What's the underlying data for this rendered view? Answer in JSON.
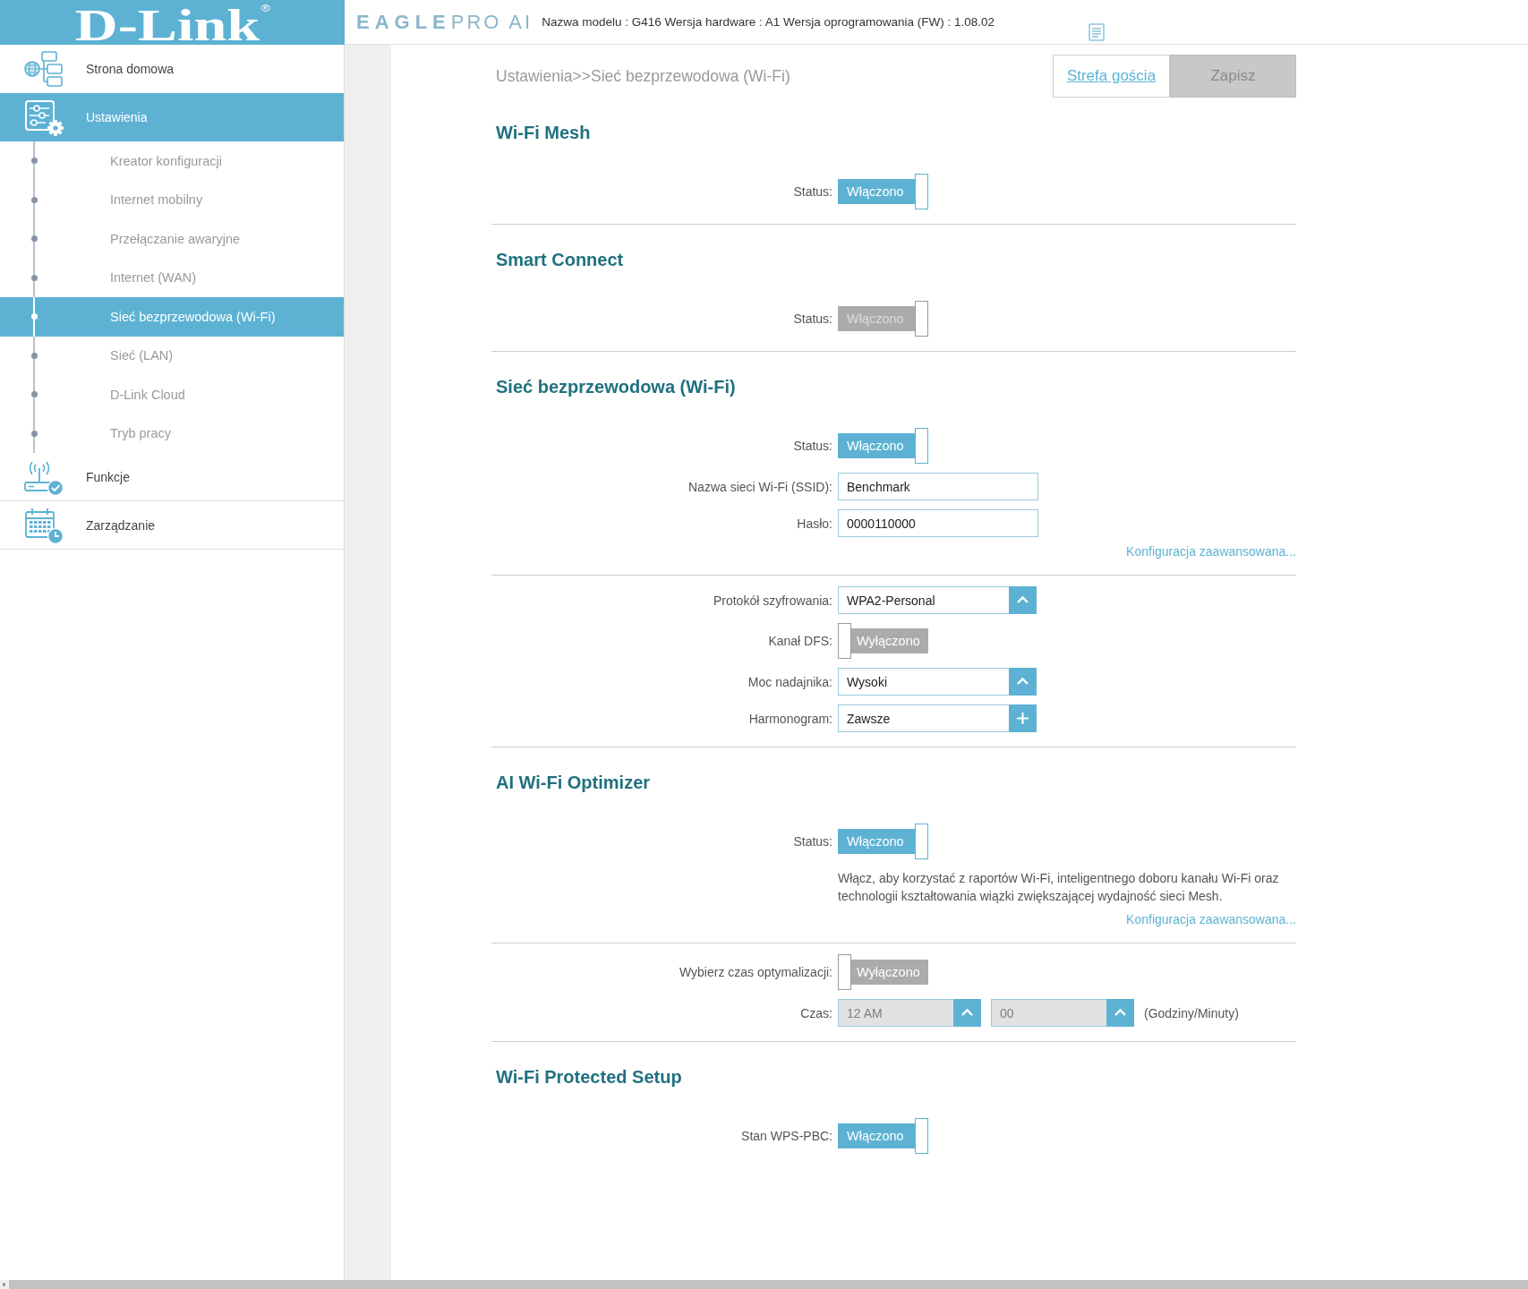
{
  "header": {
    "logo": "D-Link",
    "logo_mark": "®",
    "product": "EAGLE",
    "product_suffix": "PRO AI",
    "model_info": "Nazwa modelu : G416 Wersja hardware : A1 Wersja oprogramowania (FW) : 1.08.02"
  },
  "sidebar": {
    "items": [
      {
        "label": "Strona domowa",
        "selected": false
      },
      {
        "label": "Ustawienia",
        "selected": true,
        "children": [
          {
            "label": "Kreator konfiguracji",
            "selected": false
          },
          {
            "label": "Internet mobilny",
            "selected": false
          },
          {
            "label": "Przełączanie awaryjne",
            "selected": false
          },
          {
            "label": "Internet (WAN)",
            "selected": false
          },
          {
            "label": "Sieć bezprzewodowa (Wi-Fi)",
            "selected": true
          },
          {
            "label": "Sieć (LAN)",
            "selected": false
          },
          {
            "label": "D-Link Cloud",
            "selected": false
          },
          {
            "label": "Tryb pracy",
            "selected": false
          }
        ]
      },
      {
        "label": "Funkcje",
        "selected": false
      },
      {
        "label": "Zarządzanie",
        "selected": false
      }
    ]
  },
  "breadcrumb": "Ustawienia>>Sieć bezprzewodowa (Wi-Fi)",
  "actions": [
    {
      "kind": "link",
      "label": "Strefa gościa"
    },
    {
      "kind": "button",
      "label": "Zapisz",
      "disabled": true
    }
  ],
  "blocks": [
    {
      "title": "Wi-Fi Mesh",
      "rows": [
        {
          "kind": "toggle",
          "label": "Status:",
          "text": "Włączono",
          "on": true,
          "disabled": false
        }
      ]
    },
    {
      "title": "Smart Connect",
      "rows": [
        {
          "kind": "toggle",
          "label": "Status:",
          "text": "Włączono",
          "on": true,
          "disabled": true
        }
      ]
    },
    {
      "title": "Sieć bezprzewodowa (Wi-Fi)",
      "rows": [
        {
          "kind": "toggle",
          "label": "Status:",
          "text": "Włączono",
          "on": true,
          "disabled": false
        },
        {
          "kind": "text",
          "label": "Nazwa sieci Wi-Fi (SSID):",
          "value": "Benchmark"
        },
        {
          "kind": "text",
          "label": "Hasło:",
          "value": "0000110000"
        },
        {
          "kind": "link",
          "text": "Konfiguracja zaawansowana..."
        }
      ]
    },
    {
      "rows": [
        {
          "kind": "select",
          "label": "Protokół szyfrowania:",
          "value": "WPA2-Personal"
        },
        {
          "kind": "toggle",
          "label": "Kanał DFS:",
          "text": "Wyłączono",
          "on": false,
          "disabled": false
        },
        {
          "kind": "select",
          "label": "Moc nadajnika:",
          "value": "Wysoki"
        },
        {
          "kind": "add-select",
          "label": "Harmonogram:",
          "value": "Zawsze"
        }
      ]
    },
    {
      "title": "AI Wi-Fi Optimizer",
      "rows": [
        {
          "kind": "toggle",
          "label": "Status:",
          "text": "Włączono",
          "on": true,
          "disabled": false
        },
        {
          "kind": "note",
          "text": "Włącz, aby korzystać z raportów Wi-Fi, inteligentnego doboru kanału Wi-Fi oraz technologii kształtowania wiązki zwiększającej wydajność sieci Mesh."
        },
        {
          "kind": "link",
          "text": "Konfiguracja zaawansowana..."
        }
      ]
    },
    {
      "rows": [
        {
          "kind": "toggle",
          "label": "Wybierz czas optymalizacji:",
          "text": "Wyłączono",
          "on": false,
          "disabled": false
        },
        {
          "kind": "time",
          "label": "Czas:",
          "fields": [
            {
              "value": "12 AM"
            },
            {
              "value": "00"
            }
          ],
          "unit": "(Godziny/Minuty)",
          "disabled": true
        }
      ]
    },
    {
      "title": "Wi-Fi Protected Setup",
      "rows": [
        {
          "kind": "toggle",
          "label": "Stan WPS-PBC:",
          "text": "Włączono",
          "on": true,
          "disabled": false
        }
      ]
    }
  ]
}
